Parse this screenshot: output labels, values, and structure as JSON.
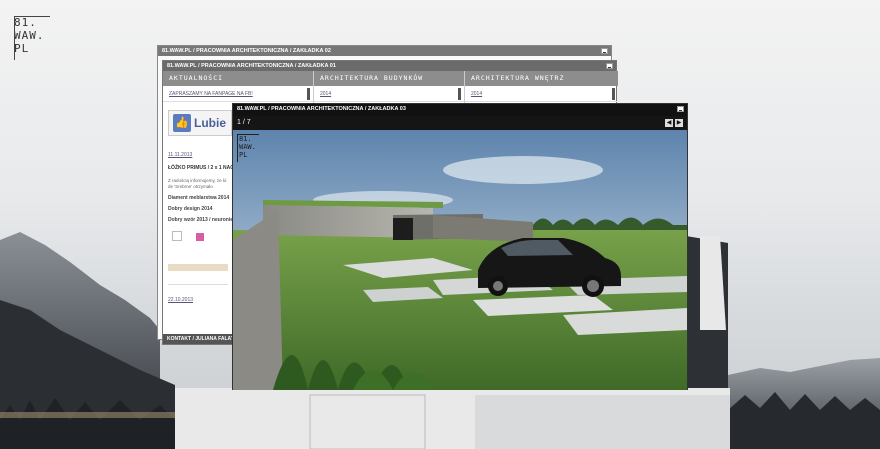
{
  "logo": {
    "lines": [
      "81.",
      "WAW.",
      "PL"
    ]
  },
  "windows": {
    "w02": {
      "title": "81.WAW.PL / PRACOWNIA ARCHITEKTONICZNA / ZAKŁADKA 02"
    },
    "w01": {
      "title": "81.WAW.PL / PRACOWNIA ARCHITEKTONICZNA / ZAKŁADKA 01",
      "columns": [
        {
          "header": "AKTUALNOŚCI",
          "first_row": "ZAPRASZAMY NA FANPAGE NA FB!"
        },
        {
          "header": "ARCHITEKTURA BUDYNKÓW",
          "first_row": "2014"
        },
        {
          "header": "ARCHITEKTURA WNĘTRZ",
          "first_row": "2014"
        }
      ],
      "news": {
        "fb_label": "Lubie",
        "date1": "11.11.2013",
        "title": "ŁÓŻKO PRIMUS / 2 x 1 NAG",
        "text": "Z radością informujemy, że łó de 'Srebrne' otrzymało",
        "items": [
          "Diament meblarstwa 2014",
          "Dobry design 2014",
          "Dobry wzór 2013 / neuronie"
        ],
        "date2": "22.10.2013"
      },
      "footer": "KONTAKT / JULIANA FALATA"
    },
    "w03": {
      "title": "81.WAW.PL / PRACOWNIA ARCHITEKTONICZNA / ZAKŁADKA 03",
      "counter": "1 / 7",
      "nav": {
        "prev": "◀",
        "next": "▶"
      },
      "image_logo": [
        "81.",
        "WAW.",
        "PL"
      ]
    }
  },
  "colors": {
    "window_bar_dark": "#111111",
    "window_bar_grey": "#6b6b6b",
    "column_header": "#8d8d8d",
    "fb_blue": "#5a7bc0",
    "grass": "#5f8a3c",
    "sky": "#8fa9c4"
  }
}
